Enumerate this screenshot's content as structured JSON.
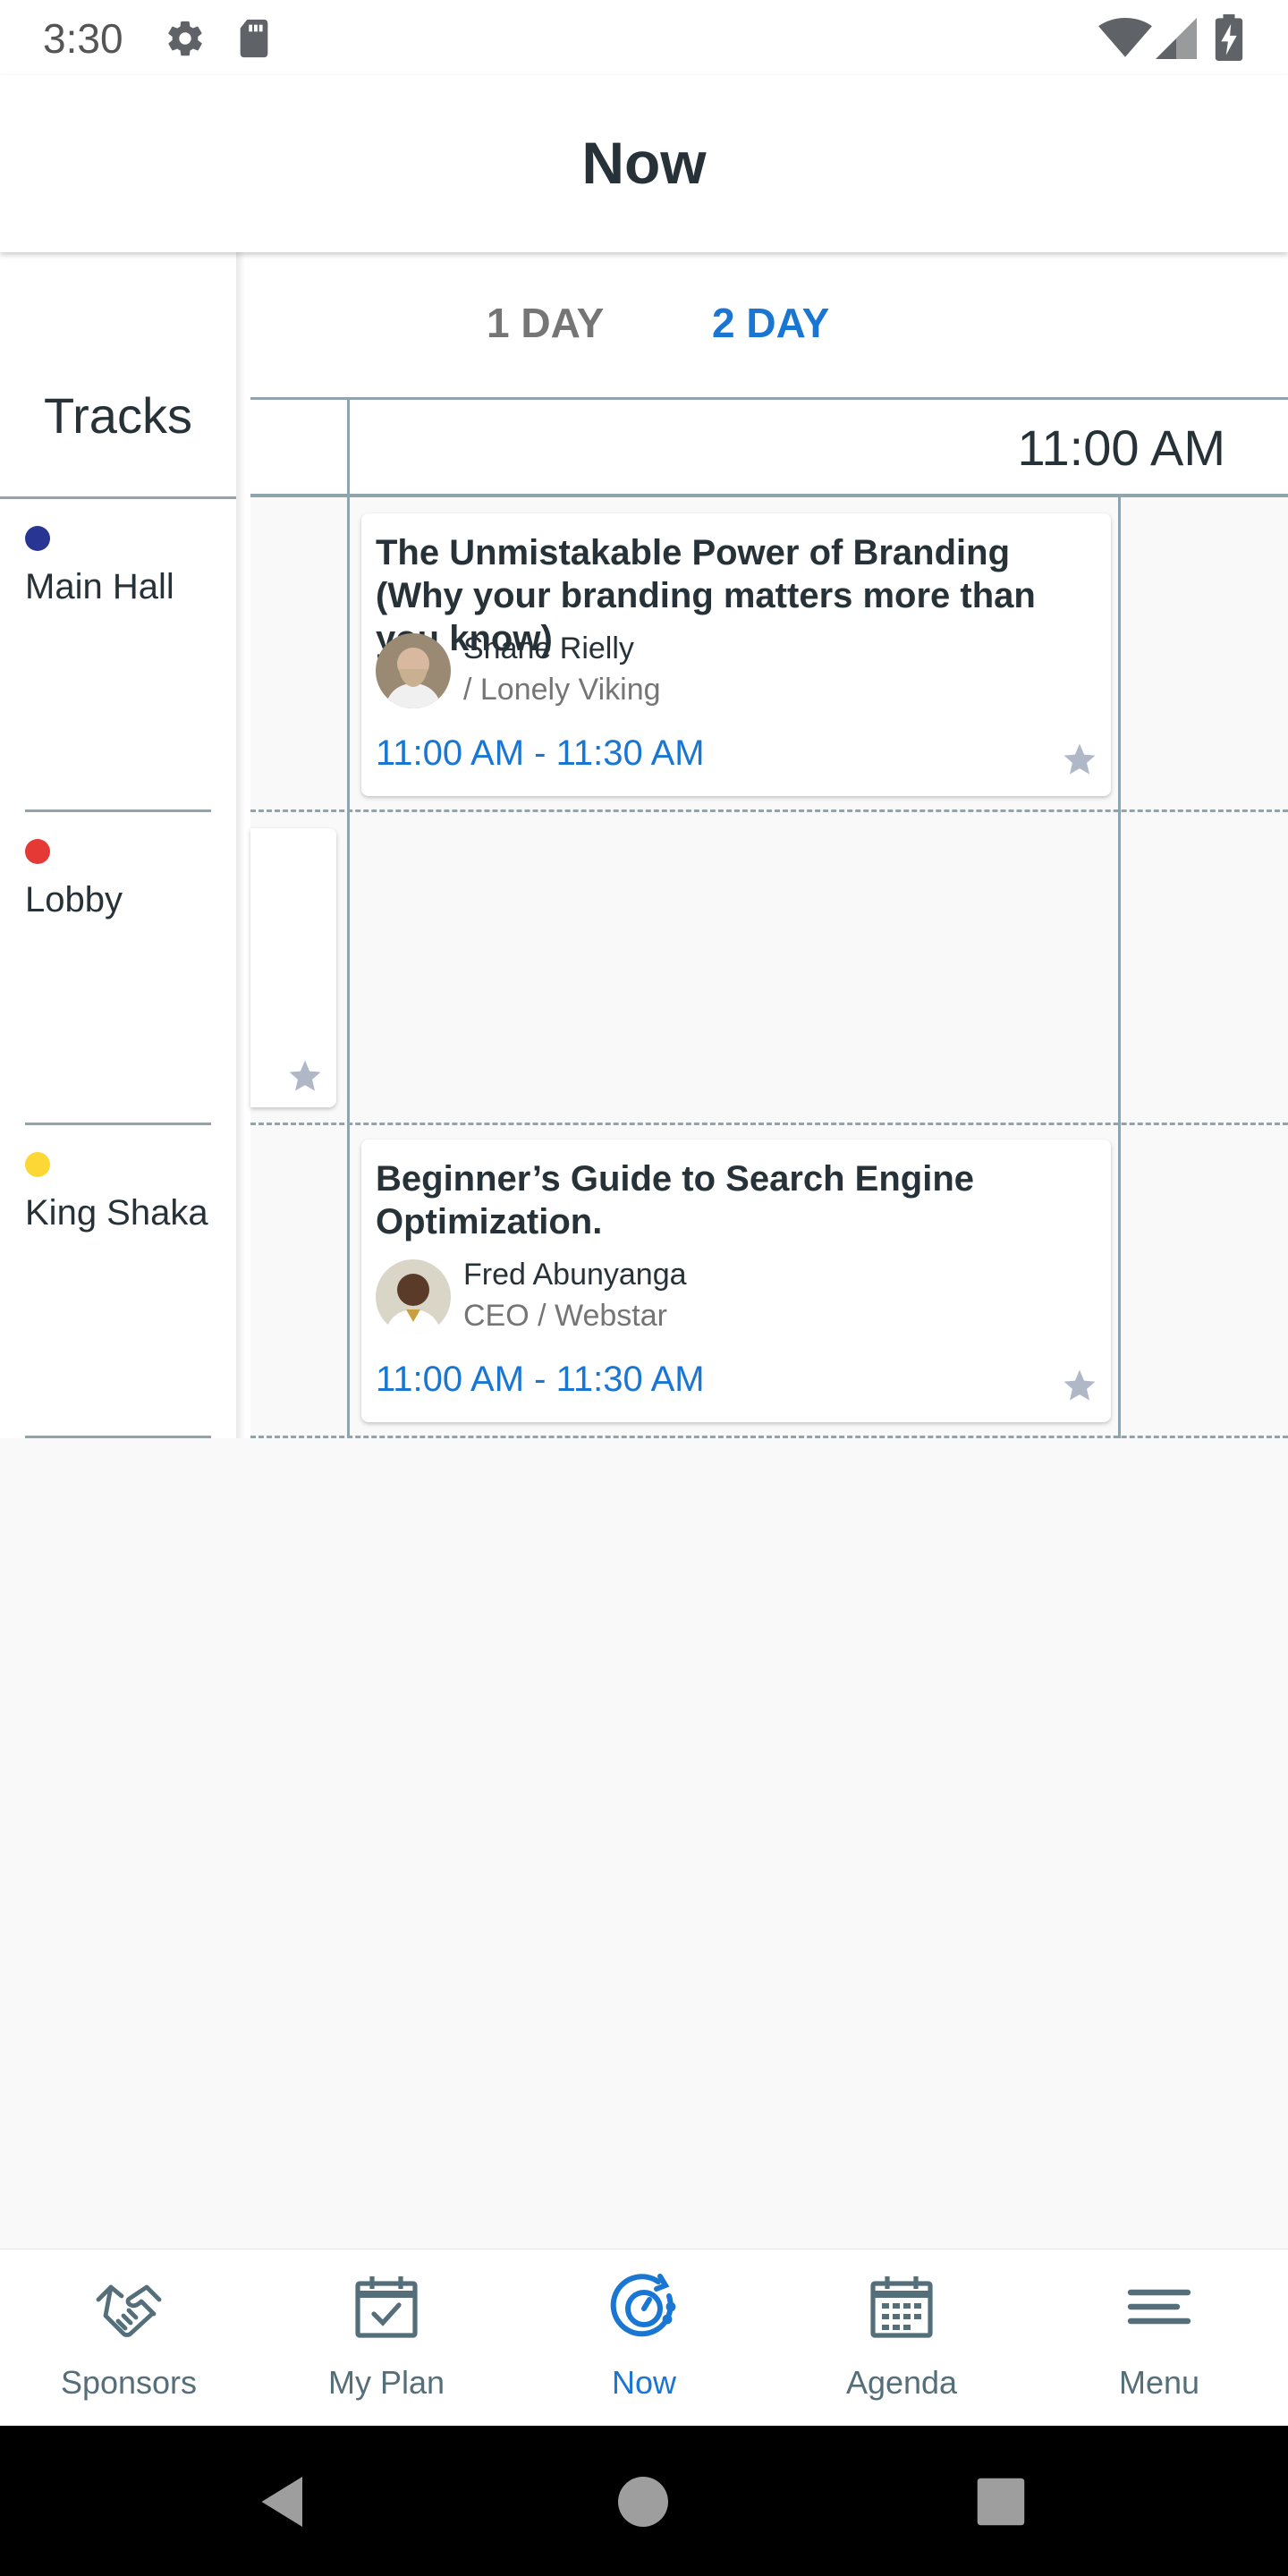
{
  "status_bar": {
    "time": "3:30",
    "icons": [
      "gear-icon",
      "sd-card-icon",
      "wifi-icon",
      "signal-icon",
      "battery-charging-icon"
    ]
  },
  "app_bar": {
    "title": "Now"
  },
  "tracks": {
    "header": "Tracks",
    "items": [
      {
        "label": "Main Hall",
        "color": "#283593"
      },
      {
        "label": "Lobby",
        "color": "#e53935"
      },
      {
        "label": "King Shaka",
        "color": "#fdd835"
      }
    ]
  },
  "day_tabs": [
    {
      "label": "1 DAY",
      "selected": false
    },
    {
      "label": "2 DAY",
      "selected": true
    }
  ],
  "time_slots": [
    "11:00 AM"
  ],
  "sessions": [
    {
      "title": "The Unmistakable Power of Branding (Why your branding matters more than you know)",
      "speaker": "Shane Rielly",
      "role": "/ Lonely Viking",
      "time": "11:00 AM - 11:30 AM",
      "track": "Main Hall"
    },
    {
      "title": "Beginner’s Guide to Search Engine Optimization.",
      "speaker": "Fred Abunyanga",
      "role": "CEO / Webstar",
      "time": "11:00 AM - 11:30 AM",
      "track": "King Shaka"
    }
  ],
  "bottom_nav": [
    {
      "label": "Sponsors",
      "icon": "handshake-icon",
      "active": false
    },
    {
      "label": "My Plan",
      "icon": "calendar-check-icon",
      "active": false
    },
    {
      "label": "Now",
      "icon": "now-clock-icon",
      "active": true
    },
    {
      "label": "Agenda",
      "icon": "calendar-grid-icon",
      "active": false
    },
    {
      "label": "Menu",
      "icon": "menu-icon",
      "active": false
    }
  ],
  "colors": {
    "accent": "#1976d2",
    "grid_line": "#90a4ae",
    "text_dark": "#263238",
    "star": "#b0b8c8"
  }
}
